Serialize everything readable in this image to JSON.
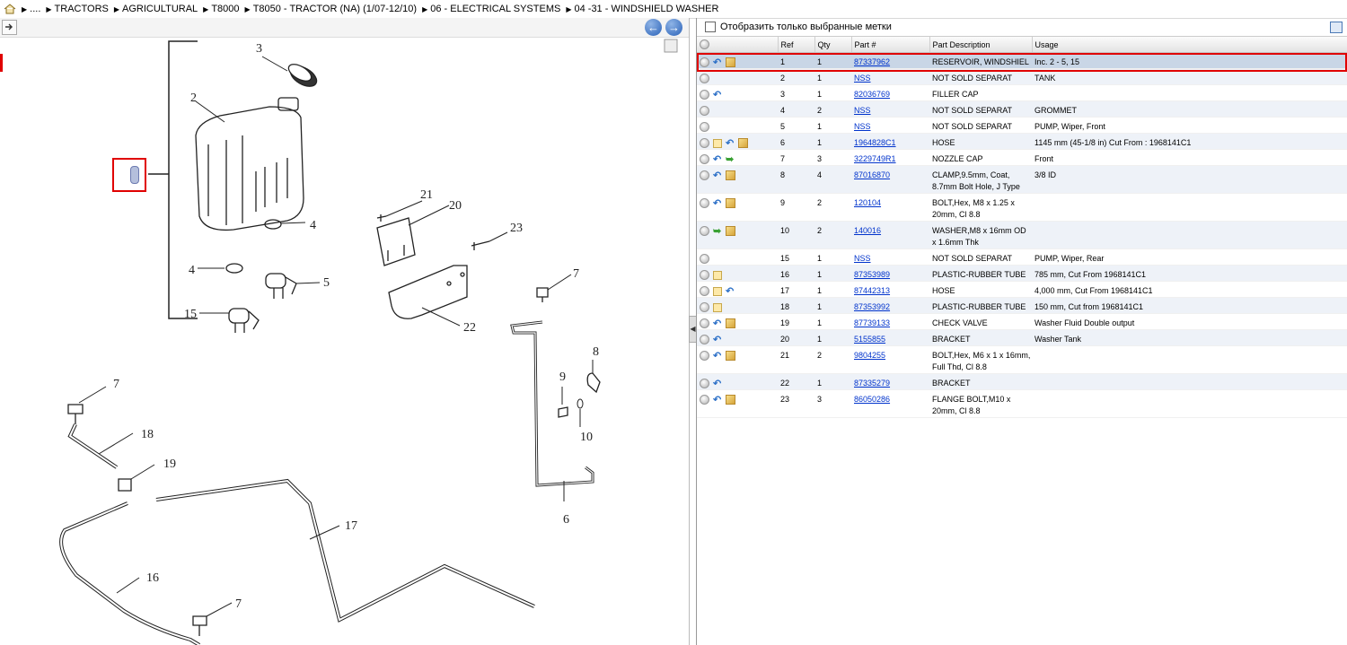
{
  "breadcrumb": {
    "items": [
      "....",
      "TRACTORS",
      "AGRICULTURAL",
      "T8000",
      "T8050 - TRACTOR (NA) (1/07-12/10)",
      "06 - ELECTRICAL SYSTEMS",
      "04 -31 - WINDSHIELD WASHER"
    ]
  },
  "filter": {
    "label": "Отобразить только выбранные метки"
  },
  "table": {
    "headers": {
      "ref": "Ref",
      "qty": "Qty",
      "part": "Part #",
      "desc": "Part Description",
      "usage": "Usage"
    },
    "rows": [
      {
        "icons": [
          "plus",
          "back",
          "box"
        ],
        "ref": "1",
        "qty": "1",
        "part": "87337962",
        "desc": "RESERVOIR, WINDSHIEL",
        "usage": "Inc.  2 - 5, 15",
        "selected": true
      },
      {
        "icons": [
          "plus"
        ],
        "ref": "2",
        "qty": "1",
        "part": "NSS",
        "desc": "NOT SOLD SEPARAT",
        "usage": "TANK"
      },
      {
        "icons": [
          "plus",
          "back"
        ],
        "ref": "3",
        "qty": "1",
        "part": "82036769",
        "desc": "FILLER CAP",
        "usage": ""
      },
      {
        "icons": [
          "plus"
        ],
        "ref": "4",
        "qty": "2",
        "part": "NSS",
        "desc": "NOT SOLD SEPARAT",
        "usage": "GROMMET"
      },
      {
        "icons": [
          "plus"
        ],
        "ref": "5",
        "qty": "1",
        "part": "NSS",
        "desc": "NOT SOLD SEPARAT",
        "usage": "PUMP, Wiper, Front"
      },
      {
        "icons": [
          "plus",
          "note",
          "back",
          "box"
        ],
        "ref": "6",
        "qty": "1",
        "part": "1964828C1",
        "desc": "HOSE",
        "usage": "1145 mm (45-1/8 in) Cut From : 1968141C1"
      },
      {
        "icons": [
          "plus",
          "back",
          "fwd"
        ],
        "ref": "7",
        "qty": "3",
        "part": "3229749R1",
        "desc": "NOZZLE CAP",
        "usage": "Front"
      },
      {
        "icons": [
          "plus",
          "back",
          "box"
        ],
        "ref": "8",
        "qty": "4",
        "part": "87016870",
        "desc": "CLAMP,9.5mm, Coat, 8.7mm Bolt Hole, J Type",
        "usage": "3/8 ID"
      },
      {
        "icons": [
          "plus",
          "back",
          "box"
        ],
        "ref": "9",
        "qty": "2",
        "part": "120104",
        "desc": "BOLT,Hex, M8 x 1.25 x 20mm, Cl 8.8",
        "usage": ""
      },
      {
        "icons": [
          "plus",
          "fwd",
          "box"
        ],
        "ref": "10",
        "qty": "2",
        "part": "140016",
        "desc": "WASHER,M8 x 16mm OD x 1.6mm Thk",
        "usage": ""
      },
      {
        "icons": [
          "plus"
        ],
        "ref": "15",
        "qty": "1",
        "part": "NSS",
        "desc": "NOT SOLD SEPARAT",
        "usage": "PUMP, Wiper, Rear"
      },
      {
        "icons": [
          "plus",
          "note"
        ],
        "ref": "16",
        "qty": "1",
        "part": "87353989",
        "desc": "PLASTIC-RUBBER TUBE",
        "usage": "785 mm, Cut From 1968141C1"
      },
      {
        "icons": [
          "plus",
          "note",
          "back"
        ],
        "ref": "17",
        "qty": "1",
        "part": "87442313",
        "desc": "HOSE",
        "usage": "4,000 mm, Cut From 1968141C1"
      },
      {
        "icons": [
          "plus",
          "note"
        ],
        "ref": "18",
        "qty": "1",
        "part": "87353992",
        "desc": "PLASTIC-RUBBER TUBE",
        "usage": "150 mm, Cut from 1968141C1"
      },
      {
        "icons": [
          "plus",
          "back",
          "box"
        ],
        "ref": "19",
        "qty": "1",
        "part": "87739133",
        "desc": "CHECK VALVE",
        "usage": "Washer Fluid Double output"
      },
      {
        "icons": [
          "plus",
          "back"
        ],
        "ref": "20",
        "qty": "1",
        "part": "5155855",
        "desc": "BRACKET",
        "usage": "Washer Tank"
      },
      {
        "icons": [
          "plus",
          "back",
          "box"
        ],
        "ref": "21",
        "qty": "2",
        "part": "9804255",
        "desc": "BOLT,Hex, M6 x 1 x 16mm, Full Thd, Cl 8.8",
        "usage": ""
      },
      {
        "icons": [
          "plus",
          "back"
        ],
        "ref": "22",
        "qty": "1",
        "part": "87335279",
        "desc": "BRACKET",
        "usage": ""
      },
      {
        "icons": [
          "plus",
          "back",
          "box"
        ],
        "ref": "23",
        "qty": "3",
        "part": "86050286",
        "desc": "FLANGE BOLT,M10 x 20mm, Cl 8.8",
        "usage": ""
      }
    ]
  },
  "diagram": {
    "labels": [
      "3",
      "2",
      "1",
      "21",
      "20",
      "23",
      "4",
      "4",
      "5",
      "15",
      "22",
      "7",
      "7",
      "18",
      "19",
      "9",
      "8",
      "10",
      "6",
      "17",
      "16",
      "7"
    ]
  },
  "colors": {
    "highlight": "#e00000",
    "link": "#0033cc",
    "selected_row": "#c9d6e6"
  }
}
